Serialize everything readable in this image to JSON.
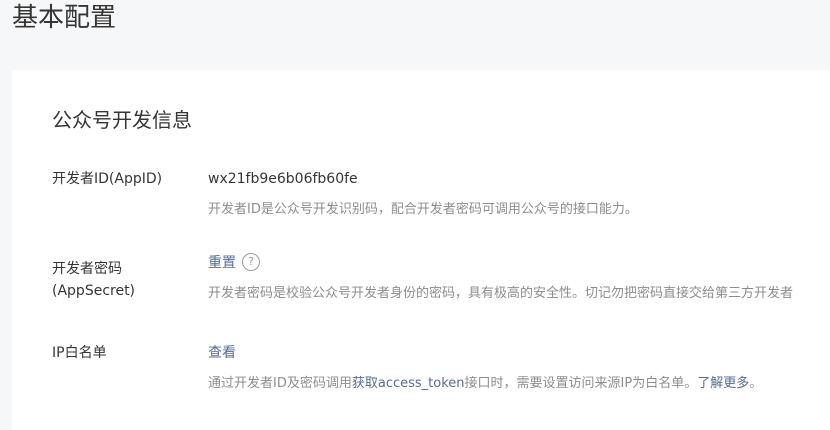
{
  "page": {
    "title": "基本配置"
  },
  "card": {
    "section_title": "公众号开发信息",
    "rows": {
      "appid": {
        "label": "开发者ID(AppID)",
        "value": "wx21fb9e6b06fb60fe",
        "desc": "开发者ID是公众号开发识别码，配合开发者密码可调用公众号的接口能力。"
      },
      "secret": {
        "label_line1": "开发者密码",
        "label_line2": "(AppSecret)",
        "action": "重置",
        "help_icon": "?",
        "desc": "开发者密码是校验公众号开发者身份的密码，具有极高的安全性。切记勿把密码直接交给第三方开发者"
      },
      "ip_whitelist": {
        "label": "IP白名单",
        "action": "查看",
        "desc_prefix": "通过开发者ID及密码调用",
        "desc_link1": "获取access_token",
        "desc_middle": "接口时，需要设置访问来源IP为白名单。",
        "desc_link2": "了解更多",
        "desc_suffix": "。"
      }
    }
  },
  "colors": {
    "link": "#576b95",
    "muted": "#8d8d8d",
    "text": "#353535",
    "background": "#f6f7f9"
  }
}
